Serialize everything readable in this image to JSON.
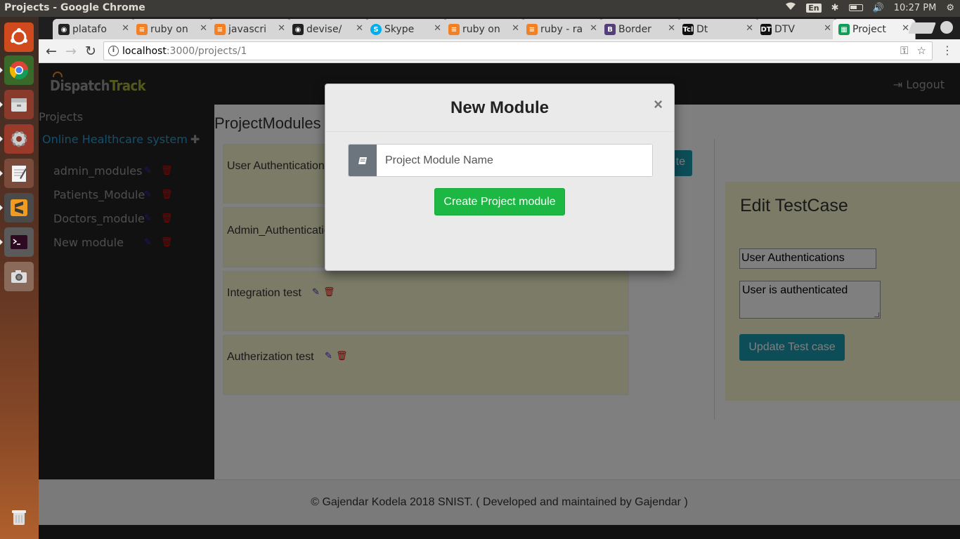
{
  "os": {
    "window_title": "Projects - Google Chrome",
    "keyboard_layout": "En",
    "clock": "10:27 PM"
  },
  "browser": {
    "tabs": [
      {
        "label": "platafo",
        "favicon": "github-icon",
        "color": "#222222"
      },
      {
        "label": "ruby on",
        "favicon": "stackoverflow-icon",
        "color": "#f48024"
      },
      {
        "label": "javascri",
        "favicon": "stackoverflow-icon",
        "color": "#f48024"
      },
      {
        "label": "devise/",
        "favicon": "github-icon",
        "color": "#222222"
      },
      {
        "label": "Skype",
        "favicon": "skype-icon",
        "color": "#00aff0"
      },
      {
        "label": "ruby on",
        "favicon": "stackoverflow-icon",
        "color": "#f48024"
      },
      {
        "label": "ruby - ra",
        "favicon": "stackoverflow-icon",
        "color": "#f48024"
      },
      {
        "label": "Border",
        "favicon": "bootstrap-icon",
        "color": "#563d7c"
      },
      {
        "label": "Dt",
        "favicon": "tcl-icon",
        "color": "#111111"
      },
      {
        "label": "DTV",
        "favicon": "dt-icon",
        "color": "#111111"
      },
      {
        "label": "Project",
        "favicon": "sheet-icon",
        "color": "#0f9d58"
      }
    ],
    "url_host": "localhost",
    "url_path": ":3000/projects/1"
  },
  "app": {
    "brand_dispatch": "Dispatch",
    "brand_track": "Track",
    "logout_label": "Logout",
    "sidebar": {
      "heading": "Projects",
      "project_name": "Online Healthcare system",
      "modules": [
        "admin_modules",
        "Patients_Module",
        "Doctors_module",
        "New module"
      ]
    },
    "main": {
      "title": "ProjectModules",
      "create_button_fragment": "te",
      "test_cases": [
        "User Authentication",
        "Admin_Authenticatio",
        "Integration test",
        "Autherization test"
      ]
    },
    "edit_panel": {
      "title": "Edit TestCase",
      "name_value": "User Authentications",
      "description_value": "User is authenticated",
      "update_label": "Update Test case"
    },
    "footer": "© Gajendar Kodela 2018 SNIST. ( Developed and maintained by Gajendar )"
  },
  "modal": {
    "title": "New Module",
    "close_label": "×",
    "input_placeholder": "Project Module Name",
    "submit_label": "Create Project module"
  },
  "colors": {
    "accent_blue": "#2a9fd6",
    "success_green": "#1db744",
    "info_teal": "#1a9ab0",
    "card_yellow": "#f7f6cf"
  }
}
